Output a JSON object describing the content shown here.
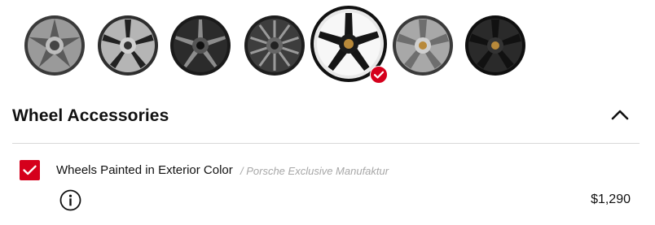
{
  "wheels": [
    {
      "name": "wheel-option-1",
      "selected": false,
      "finish": "silver"
    },
    {
      "name": "wheel-option-2",
      "selected": false,
      "finish": "silver-black"
    },
    {
      "name": "wheel-option-3",
      "selected": false,
      "finish": "black-machined"
    },
    {
      "name": "wheel-option-4",
      "selected": false,
      "finish": "dark-machined"
    },
    {
      "name": "wheel-option-5",
      "selected": true,
      "finish": "black-polished"
    },
    {
      "name": "wheel-option-6",
      "selected": false,
      "finish": "silver"
    },
    {
      "name": "wheel-option-7",
      "selected": false,
      "finish": "black"
    }
  ],
  "section": {
    "title": "Wheel Accessories",
    "expanded": true
  },
  "accessory": {
    "checked": true,
    "label": "Wheels Painted in Exterior Color",
    "subtitle": "/ Porsche Exclusive Manufaktur",
    "price": "$1,290"
  },
  "colors": {
    "accent": "#d5001c",
    "text": "#111111",
    "muted": "#a7a7a7",
    "divider": "#d8d8d8"
  },
  "icons": {
    "selected_badge": "check-circle-icon",
    "collapse": "chevron-up-icon",
    "checkbox": "checkmark-icon",
    "info": "info-icon"
  }
}
